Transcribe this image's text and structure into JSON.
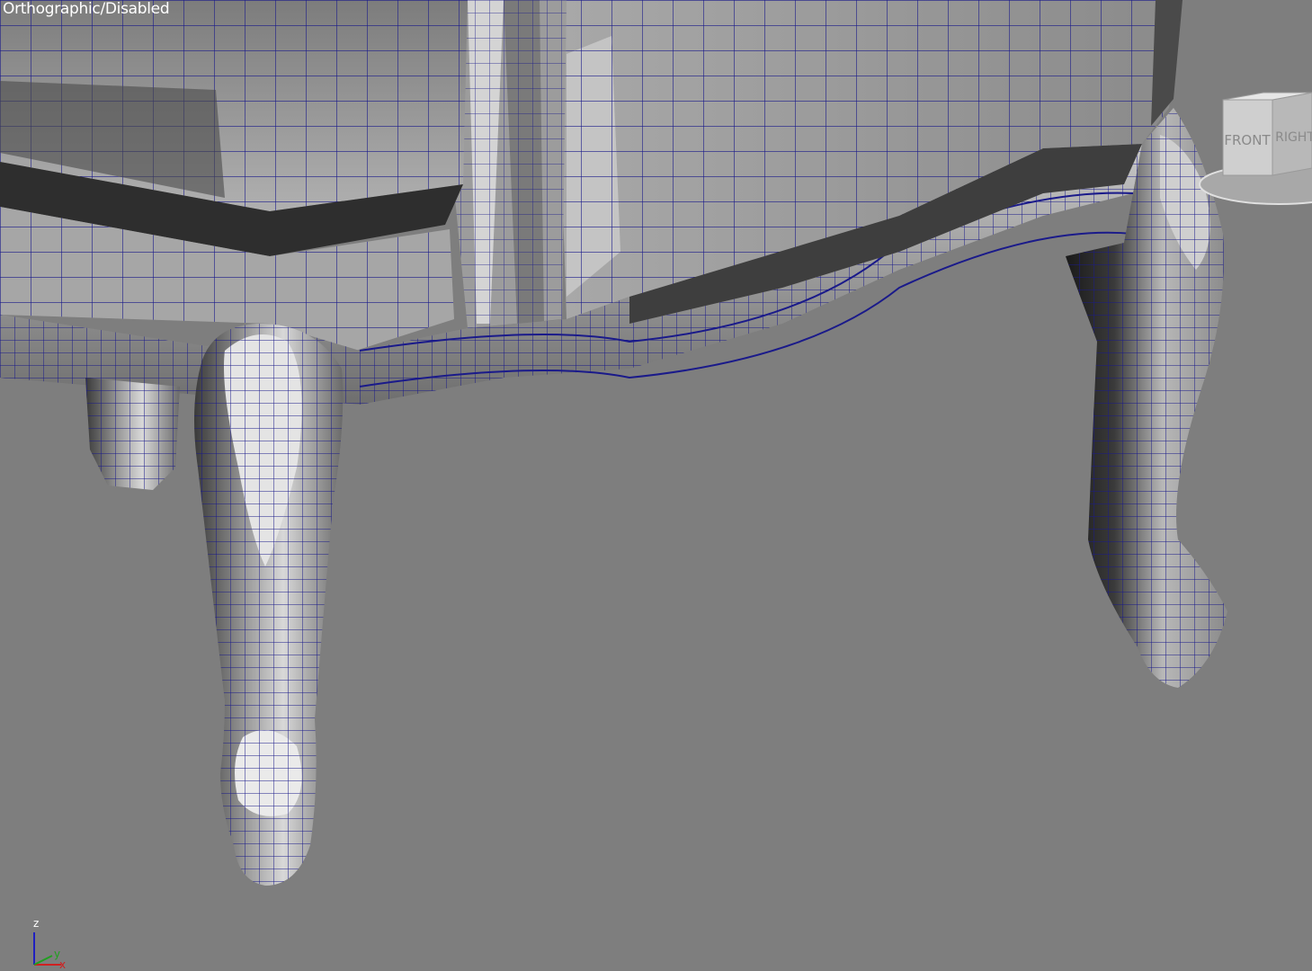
{
  "viewport": {
    "label": "Orthographic/Disabled",
    "background_color": "#7e7e7e",
    "wire_color": "#1a1a8a"
  },
  "viewcube": {
    "face_front": "FRONT",
    "face_right": "RIGHT"
  },
  "axis_gizmo": {
    "z_label": "z",
    "x_label": "x",
    "y_label": "y",
    "x_color": "#d02020",
    "y_color": "#20a020",
    "z_color": "#2020c0"
  },
  "model": {
    "icon": "chair-mesh"
  }
}
